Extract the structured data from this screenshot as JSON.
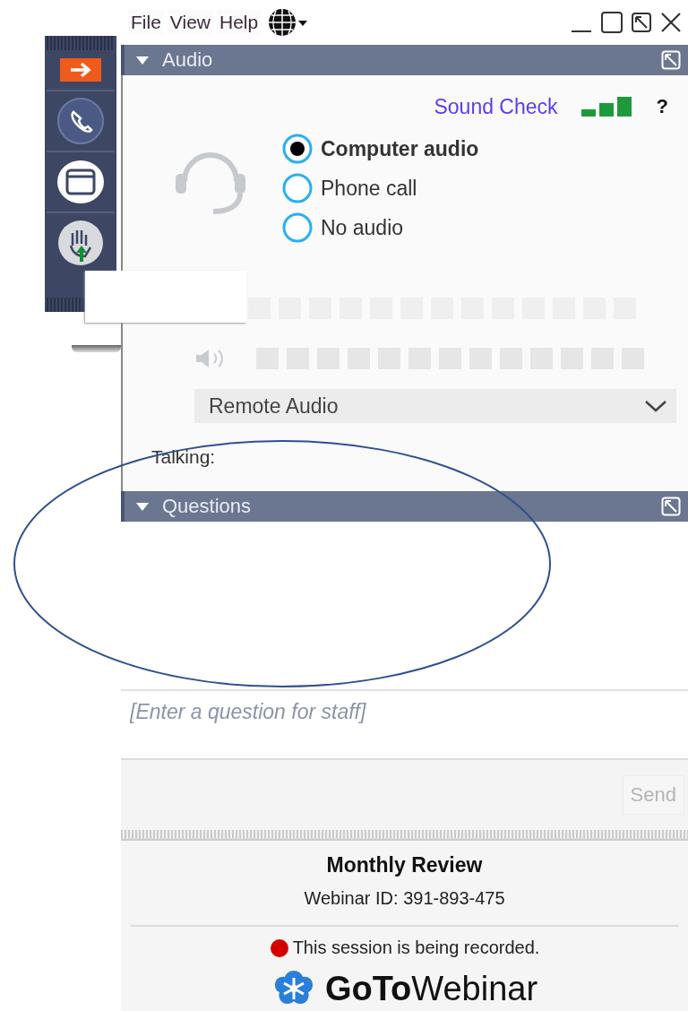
{
  "menu": [
    {
      "label": "File"
    },
    {
      "label": "View"
    },
    {
      "label": "Help"
    }
  ],
  "audio": {
    "title": "Audio",
    "expanded": true,
    "sound_check": "Sound Check",
    "help": "?",
    "options": [
      {
        "label": "Computer audio",
        "selected": true
      },
      {
        "label": "Phone call",
        "selected": false
      },
      {
        "label": "No audio",
        "selected": false
      }
    ],
    "speaker": "Remote Audio",
    "talking_label": "Talking:"
  },
  "questions": {
    "title": "Questions",
    "expanded": true,
    "placeholder": "[Enter a question for staff]",
    "send": "Send",
    "send_disabled": true
  },
  "footer": {
    "title": "Monthly Review",
    "webinar_id": "Webinar ID: 391-893-475",
    "recording": "This session is being recorded.",
    "logo": "**GoTo**Webinar"
  }
}
